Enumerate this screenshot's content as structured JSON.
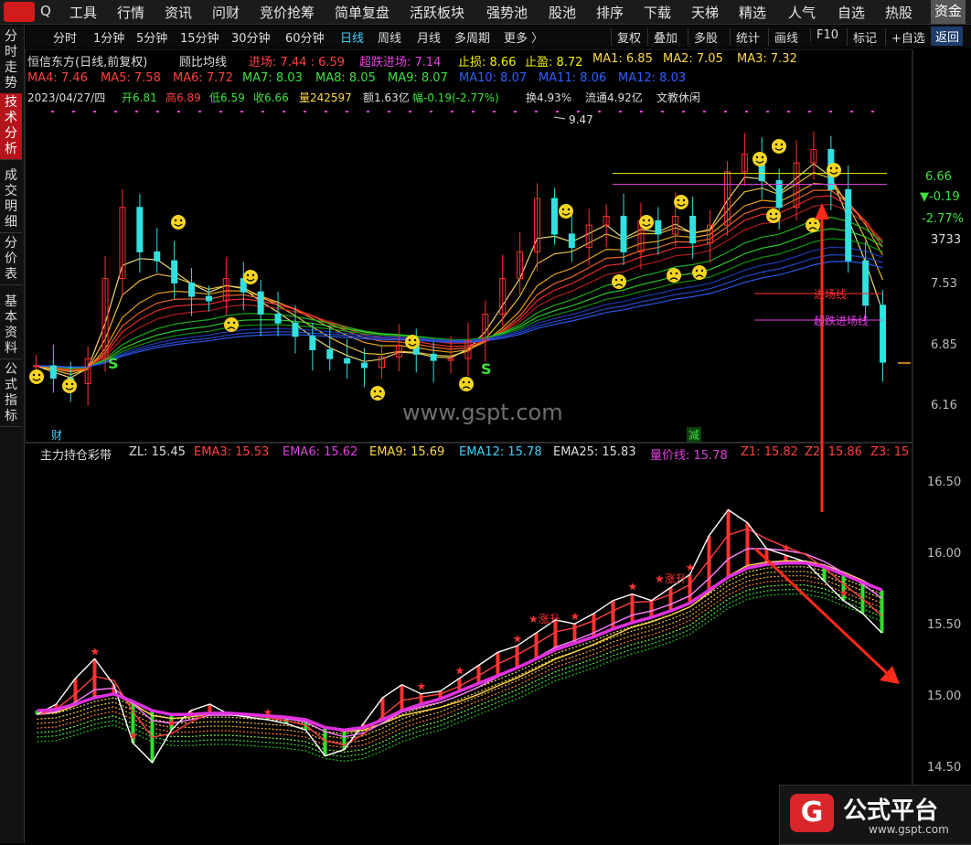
{
  "topbar": {
    "search_icon": "Q",
    "items": [
      "工具",
      "行情",
      "资讯",
      "问财",
      "竞价抢筹",
      "简单复盘",
      "活跃板块",
      "强势池",
      "股池",
      "排序",
      "下载",
      "天梯",
      "精选",
      "人气",
      "自选",
      "热股",
      "资金"
    ]
  },
  "periodbar": {
    "items": [
      "分时",
      "1分钟",
      "5分钟",
      "15分钟",
      "30分钟",
      "60分钟",
      "日线",
      "周线",
      "月线",
      "多周期",
      "更多 〉"
    ],
    "active": "日线",
    "buttons": [
      "复权",
      "叠加",
      "多股",
      "统计",
      "画线",
      "F10",
      "标记",
      "+自选",
      "返回"
    ]
  },
  "left_tabs": [
    "分时走势",
    "技术分析",
    "成交明细",
    "分价表",
    "基本资料",
    "公式指标"
  ],
  "main_panel": {
    "title": "恒信东方(日线,前复权)",
    "indicator": "顾比均线",
    "entry": "进场: 7.44 : 6.59",
    "super_entry": "超跌进场: 7.14",
    "stop_loss": "止损: 8.66",
    "take_profit": "止盈: 8.72",
    "ma_row1": [
      "MA1: 6.85",
      "MA2: 7.05",
      "MA3: 7.32"
    ],
    "ma_row2": [
      "MA4: 7.46",
      "MA5: 7.58",
      "MA6: 7.72",
      "MA7: 8.03",
      "MA8: 8.05",
      "MA9: 8.07",
      "MA10: 8.07",
      "MA11: 8.06",
      "MA12: 8.03"
    ],
    "date_line": "2023/04/27/四",
    "open": "开6.81",
    "high": "高6.89",
    "low": "低6.59",
    "close": "收6.66",
    "volume": "量242597",
    "amount": "额1.63亿",
    "change": "幅-0.19(-2.77%)",
    "turnover": "换4.93%",
    "float": "流通4.92亿",
    "sector": "文教休闲",
    "peak_label": "9.47",
    "s_labels": [
      "S",
      "S"
    ],
    "cai_label": "财",
    "jian_label": "减",
    "entry_line_label": "进场线",
    "super_line_label": "超跌进场线",
    "last_price": "6.66",
    "last_change": "▼-0.19",
    "last_pct": "-2.77%",
    "last_vol": "3733",
    "y_ticks": [
      "7.53",
      "6.85",
      "6.16"
    ]
  },
  "sub_panel": {
    "title": "主力持仓彩带",
    "values": [
      "ZL: 15.45",
      "EMA3: 15.53",
      "EMA6: 15.62",
      "EMA9: 15.69",
      "EMA12: 15.78",
      "EMA25: 15.83",
      "量价线: 15.78",
      "Z1: 15.82",
      "Z2: 15.86",
      "Z3: 15"
    ],
    "labels": [
      "★涨升",
      "★涨升"
    ],
    "y_ticks": [
      "16.50",
      "16.00",
      "15.50",
      "15.00",
      "14.50"
    ]
  },
  "watermark": "www.gspt.com",
  "brand": {
    "name": "公式平台",
    "url": "www.gspt.com",
    "icon": "G"
  },
  "colors": {
    "up": "#ff3030",
    "down": "#33e0e0",
    "accent": "#e03ce0",
    "bg": "#000000",
    "arrow": "#ff2a1a"
  },
  "chart_data": [
    {
      "type": "candlestick",
      "title": "恒信东方(日线,前复权)",
      "ylim": [
        5.9,
        9.6
      ],
      "y_ticks": [
        6.16,
        6.85,
        7.53
      ],
      "close": [
        6.62,
        6.48,
        6.42,
        6.7,
        7.6,
        8.4,
        7.9,
        7.8,
        7.55,
        7.4,
        7.35,
        7.6,
        7.45,
        7.2,
        7.1,
        6.95,
        6.8,
        6.7,
        6.65,
        6.6,
        6.72,
        6.85,
        6.75,
        6.68,
        6.7,
        6.9,
        7.2,
        7.6,
        7.9,
        8.5,
        8.1,
        7.95,
        8.2,
        8.3,
        7.9,
        8.25,
        8.1,
        8.3,
        8.0,
        8.2,
        8.8,
        9.0,
        8.7,
        8.4,
        8.9,
        9.05,
        8.6,
        7.8,
        7.3,
        6.66
      ],
      "lines": {
        "stop_loss": 8.66,
        "take_profit": 8.72,
        "entry": 7.44,
        "super_entry": 7.14
      },
      "peak": 9.47,
      "last": {
        "price": 6.66,
        "change": -0.19,
        "pct": -2.77
      }
    },
    {
      "type": "line",
      "title": "主力持仓彩带",
      "ylim": [
        14.3,
        16.7
      ],
      "y_ticks": [
        14.5,
        15.0,
        15.5,
        16.0,
        16.5
      ],
      "ZL": [
        14.82,
        14.9,
        15.1,
        15.25,
        15.05,
        14.6,
        14.45,
        14.7,
        14.85,
        14.9,
        14.82,
        14.8,
        14.78,
        14.75,
        14.7,
        14.5,
        14.55,
        14.75,
        14.95,
        15.05,
        14.98,
        15.0,
        15.1,
        15.2,
        15.3,
        15.35,
        15.45,
        15.55,
        15.52,
        15.6,
        15.7,
        15.75,
        15.7,
        15.8,
        15.9,
        16.2,
        16.4,
        16.3,
        16.1,
        16.05,
        16.0,
        15.85,
        15.7,
        15.6,
        15.45
      ],
      "EMA12": [
        14.85,
        14.86,
        14.9,
        14.95,
        14.98,
        14.92,
        14.85,
        14.82,
        14.82,
        14.83,
        14.83,
        14.82,
        14.81,
        14.8,
        14.78,
        14.72,
        14.7,
        14.72,
        14.78,
        14.85,
        14.9,
        14.94,
        15.0,
        15.06,
        15.12,
        15.18,
        15.25,
        15.32,
        15.37,
        15.42,
        15.48,
        15.53,
        15.57,
        15.62,
        15.68,
        15.78,
        15.88,
        15.95,
        15.98,
        15.99,
        15.99,
        15.96,
        15.9,
        15.84,
        15.78
      ]
    }
  ]
}
